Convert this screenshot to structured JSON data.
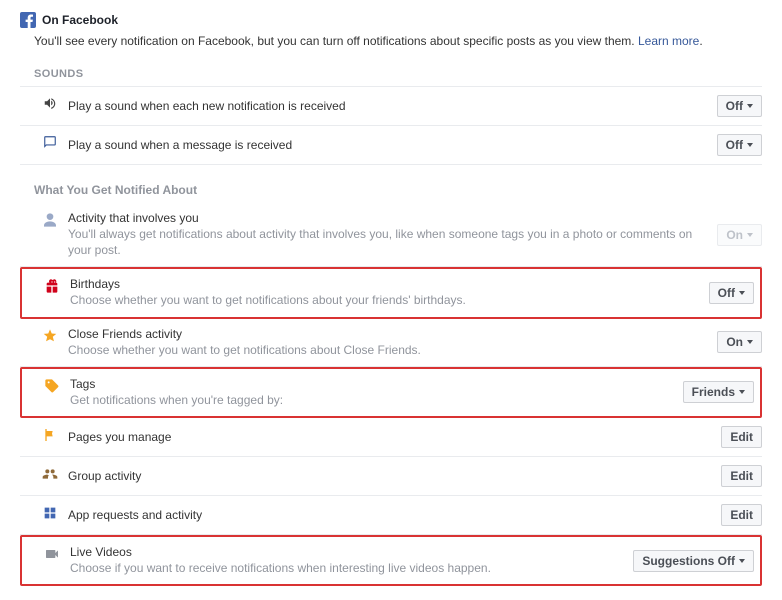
{
  "header": {
    "title": "On Facebook"
  },
  "intro": {
    "text": "You'll see every notification on Facebook, but you can turn off notifications about specific posts as you view them. ",
    "link": "Learn more"
  },
  "sounds": {
    "label": "SOUNDS",
    "rows": [
      {
        "title": "Play a sound when each new notification is received",
        "button": "Off"
      },
      {
        "title": "Play a sound when a message is received",
        "button": "Off"
      }
    ]
  },
  "notify": {
    "label": "What You Get Notified About",
    "activity": {
      "title": "Activity that involves you",
      "desc": "You'll always get notifications about activity that involves you, like when someone tags you in a photo or comments on your post.",
      "button": "On"
    },
    "birthdays": {
      "title": "Birthdays",
      "desc": "Choose whether you want to get notifications about your friends' birthdays.",
      "button": "Off"
    },
    "closefriends": {
      "title": "Close Friends activity",
      "desc": "Choose whether you want to get notifications about Close Friends.",
      "button": "On"
    },
    "tags": {
      "title": "Tags",
      "desc": "Get notifications when you're tagged by:",
      "button": "Friends"
    },
    "pages": {
      "title": "Pages you manage",
      "button": "Edit"
    },
    "groups": {
      "title": "Group activity",
      "button": "Edit"
    },
    "apps": {
      "title": "App requests and activity",
      "button": "Edit"
    },
    "live": {
      "title": "Live Videos",
      "desc": "Choose if you want to receive notifications when interesting live videos happen.",
      "button": "Suggestions Off"
    }
  }
}
